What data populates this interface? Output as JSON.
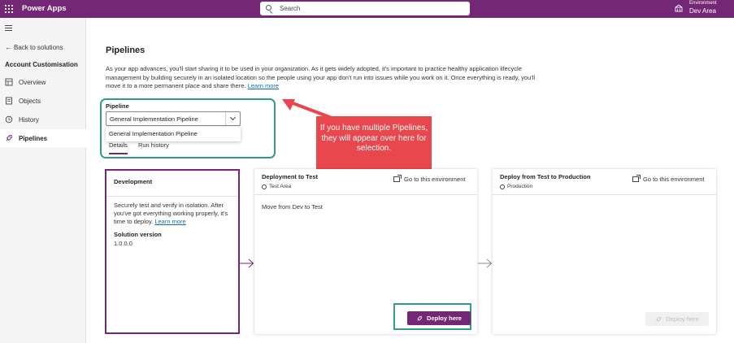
{
  "topbar": {
    "app_title": "Power Apps",
    "search_placeholder": "Search",
    "environment_label": "Environment",
    "environment_name": "Dev Area",
    "color": "#742774"
  },
  "sidebar": {
    "back_label": "Back to solutions",
    "solution_name": "Account Customisation",
    "items": [
      {
        "label": "Overview",
        "icon": "overview-icon",
        "active": false
      },
      {
        "label": "Objects",
        "icon": "objects-icon",
        "active": false
      },
      {
        "label": "History",
        "icon": "history-icon",
        "active": false
      },
      {
        "label": "Pipelines",
        "icon": "rocket-icon",
        "active": true
      }
    ]
  },
  "main": {
    "title": "Pipelines",
    "description": "As your app advances, you'll start sharing it to be used in your organization. As it gets widely adopted, it's important to practice healthy application lifecycle management by building securely in an isolated location so the people using your app don't run into issues while you work on it. Once everything is ready, you'll move it to a more permanent place and share there.",
    "learn_more": "Learn more",
    "pipeline_label": "Pipeline",
    "pipeline_selected": "General Implementation Pipeline",
    "pipeline_options": [
      "General Implementation Pipeline"
    ],
    "tabs": [
      {
        "label": "Details",
        "active": true
      },
      {
        "label": "Run history",
        "active": false
      }
    ]
  },
  "callout": {
    "text": "If you have multiple Pipelines, they will appear over here for selection.",
    "color": "#e8474d",
    "highlight_color": "#2e9e8a"
  },
  "stages": {
    "development": {
      "title": "Development",
      "description": "Securely test and verify in isolation. After you've got everything working properly, it's time to deploy.",
      "learn_more": "Learn more",
      "solution_version_label": "Solution version",
      "solution_version": "1.0.0.0"
    },
    "test": {
      "title": "Deployment to Test",
      "environment": "Test Area",
      "goto_label": "Go to this environment",
      "body": "Move from Dev to Test",
      "deploy_label": "Deploy here"
    },
    "production": {
      "title": "Deploy from Test to Production",
      "environment": "Production",
      "goto_label": "Go to this environment",
      "deploy_label": "Deploy here"
    }
  }
}
